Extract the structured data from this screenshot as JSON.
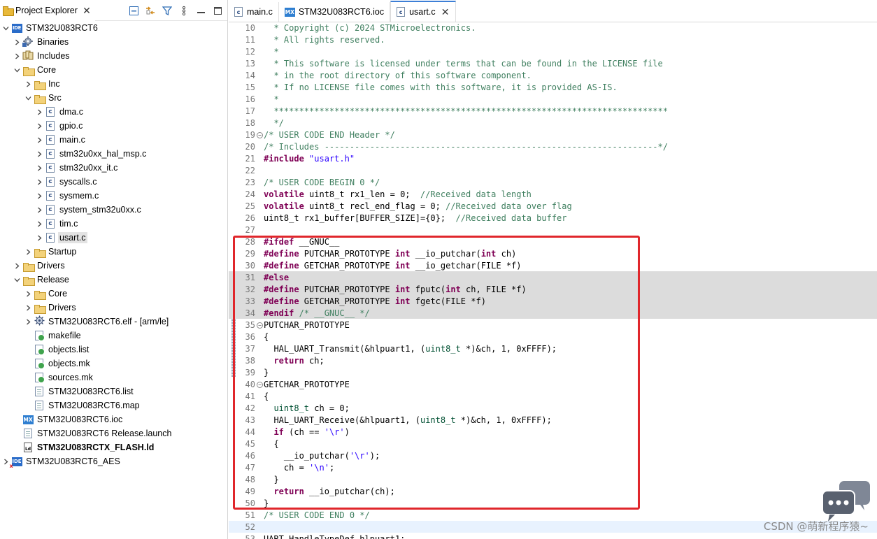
{
  "explorer": {
    "tab_label": "Project Explorer",
    "tree": [
      {
        "depth": 0,
        "arrow": "down",
        "icon": "ide",
        "label": "STM32U083RCT6"
      },
      {
        "depth": 1,
        "arrow": "right",
        "icon": "binaries",
        "label": "Binaries"
      },
      {
        "depth": 1,
        "arrow": "right",
        "icon": "includes",
        "label": "Includes"
      },
      {
        "depth": 1,
        "arrow": "down",
        "icon": "folder",
        "label": "Core"
      },
      {
        "depth": 2,
        "arrow": "right",
        "icon": "folder",
        "label": "Inc"
      },
      {
        "depth": 2,
        "arrow": "down",
        "icon": "folder",
        "label": "Src"
      },
      {
        "depth": 3,
        "arrow": "right",
        "icon": "cfile",
        "label": "dma.c"
      },
      {
        "depth": 3,
        "arrow": "right",
        "icon": "cfile",
        "label": "gpio.c"
      },
      {
        "depth": 3,
        "arrow": "right",
        "icon": "cfile",
        "label": "main.c"
      },
      {
        "depth": 3,
        "arrow": "right",
        "icon": "cfile",
        "label": "stm32u0xx_hal_msp.c"
      },
      {
        "depth": 3,
        "arrow": "right",
        "icon": "cfile",
        "label": "stm32u0xx_it.c"
      },
      {
        "depth": 3,
        "arrow": "right",
        "icon": "cfile",
        "label": "syscalls.c"
      },
      {
        "depth": 3,
        "arrow": "right",
        "icon": "cfile",
        "label": "sysmem.c"
      },
      {
        "depth": 3,
        "arrow": "right",
        "icon": "cfile",
        "label": "system_stm32u0xx.c"
      },
      {
        "depth": 3,
        "arrow": "right",
        "icon": "cfile",
        "label": "tim.c"
      },
      {
        "depth": 3,
        "arrow": "right",
        "icon": "cfile",
        "label": "usart.c",
        "selected": true
      },
      {
        "depth": 2,
        "arrow": "right",
        "icon": "folder",
        "label": "Startup"
      },
      {
        "depth": 1,
        "arrow": "right",
        "icon": "folder",
        "label": "Drivers"
      },
      {
        "depth": 1,
        "arrow": "down",
        "icon": "folder",
        "label": "Release"
      },
      {
        "depth": 2,
        "arrow": "right",
        "icon": "folder",
        "label": "Core"
      },
      {
        "depth": 2,
        "arrow": "right",
        "icon": "folder",
        "label": "Drivers"
      },
      {
        "depth": 2,
        "arrow": "right",
        "icon": "elf",
        "label": "STM32U083RCT6.elf - [arm/le]"
      },
      {
        "depth": 2,
        "arrow": "none",
        "icon": "mk",
        "label": "makefile"
      },
      {
        "depth": 2,
        "arrow": "none",
        "icon": "mk",
        "label": "objects.list"
      },
      {
        "depth": 2,
        "arrow": "none",
        "icon": "mk",
        "label": "objects.mk"
      },
      {
        "depth": 2,
        "arrow": "none",
        "icon": "mk",
        "label": "sources.mk"
      },
      {
        "depth": 2,
        "arrow": "none",
        "icon": "doc",
        "label": "STM32U083RCT6.list"
      },
      {
        "depth": 2,
        "arrow": "none",
        "icon": "doc",
        "label": "STM32U083RCT6.map"
      },
      {
        "depth": 1,
        "arrow": "none",
        "icon": "mx",
        "label": "STM32U083RCT6.ioc"
      },
      {
        "depth": 1,
        "arrow": "none",
        "icon": "doc",
        "label": "STM32U083RCT6 Release.launch"
      },
      {
        "depth": 1,
        "arrow": "none",
        "icon": "ld",
        "label": "STM32U083RCTX_FLASH.ld",
        "bold": true
      },
      {
        "depth": 0,
        "arrow": "right",
        "icon": "ide-x",
        "label": "STM32U083RCT6_AES"
      }
    ]
  },
  "editor": {
    "tabs": [
      {
        "label": "main.c",
        "icon": "cfile",
        "active": false
      },
      {
        "label": "STM32U083RCT6.ioc",
        "icon": "mx",
        "active": false
      },
      {
        "label": "usart.c",
        "icon": "cfile",
        "active": true
      }
    ],
    "lines": [
      {
        "n": "10",
        "seg": [
          [
            "com",
            "  * Copyright (c) 2024 STMicroelectronics."
          ]
        ]
      },
      {
        "n": "11",
        "seg": [
          [
            "com",
            "  * All rights reserved."
          ]
        ]
      },
      {
        "n": "12",
        "seg": [
          [
            "com",
            "  *"
          ]
        ]
      },
      {
        "n": "13",
        "seg": [
          [
            "com",
            "  * This software is licensed under terms that can be found in the LICENSE file"
          ]
        ]
      },
      {
        "n": "14",
        "seg": [
          [
            "com",
            "  * in the root directory of this software component."
          ]
        ]
      },
      {
        "n": "15",
        "seg": [
          [
            "com",
            "  * If no LICENSE file comes with this software, it is provided AS-IS."
          ]
        ]
      },
      {
        "n": "16",
        "seg": [
          [
            "com",
            "  *"
          ]
        ]
      },
      {
        "n": "17",
        "seg": [
          [
            "com",
            "  ******************************************************************************"
          ]
        ]
      },
      {
        "n": "18",
        "seg": [
          [
            "com",
            "  */"
          ]
        ]
      },
      {
        "n": "19",
        "fold": true,
        "seg": [
          [
            "com",
            "/* USER CODE END Header */"
          ]
        ]
      },
      {
        "n": "20",
        "seg": [
          [
            "com",
            "/* Includes ------------------------------------------------------------------*/"
          ]
        ]
      },
      {
        "n": "21",
        "seg": [
          [
            "pp",
            "#include "
          ],
          [
            "str",
            "\"usart.h\""
          ]
        ]
      },
      {
        "n": "22",
        "seg": [
          [
            "plain",
            ""
          ]
        ]
      },
      {
        "n": "23",
        "seg": [
          [
            "com",
            "/* USER CODE BEGIN 0 */"
          ]
        ]
      },
      {
        "n": "24",
        "seg": [
          [
            "kw",
            "volatile"
          ],
          [
            "plain",
            " uint8_t rx1_len = 0;  "
          ],
          [
            "com",
            "//Received data length"
          ]
        ]
      },
      {
        "n": "25",
        "seg": [
          [
            "kw",
            "volatile"
          ],
          [
            "plain",
            " uint8_t recl_end_flag = 0; "
          ],
          [
            "com",
            "//Received data over flag"
          ]
        ]
      },
      {
        "n": "26",
        "seg": [
          [
            "plain",
            "uint8_t rx1_buffer[BUFFER_SIZE]={0};  "
          ],
          [
            "com",
            "//Received data buffer"
          ]
        ]
      },
      {
        "n": "27",
        "seg": [
          [
            "plain",
            ""
          ]
        ]
      },
      {
        "n": "28",
        "seg": [
          [
            "pp",
            "#ifdef"
          ],
          [
            "plain",
            " __GNUC__"
          ]
        ]
      },
      {
        "n": "29",
        "seg": [
          [
            "pp",
            "#define"
          ],
          [
            "plain",
            " PUTCHAR_PROTOTYPE "
          ],
          [
            "kw",
            "int"
          ],
          [
            "plain",
            " __io_putchar("
          ],
          [
            "kw",
            "int"
          ],
          [
            "plain",
            " ch)"
          ]
        ]
      },
      {
        "n": "30",
        "seg": [
          [
            "pp",
            "#define"
          ],
          [
            "plain",
            " GETCHAR_PROTOTYPE "
          ],
          [
            "kw",
            "int"
          ],
          [
            "plain",
            " __io_getchar(FILE *f)"
          ]
        ]
      },
      {
        "n": "31",
        "hl": true,
        "seg": [
          [
            "pp",
            "#else"
          ]
        ]
      },
      {
        "n": "32",
        "hl": true,
        "seg": [
          [
            "pp",
            "#define"
          ],
          [
            "plain",
            " PUTCHAR_PROTOTYPE "
          ],
          [
            "kw",
            "int"
          ],
          [
            "plain",
            " fputc("
          ],
          [
            "kw",
            "int"
          ],
          [
            "plain",
            " ch, FILE *f)"
          ]
        ]
      },
      {
        "n": "33",
        "hl": true,
        "seg": [
          [
            "pp",
            "#define"
          ],
          [
            "plain",
            " GETCHAR_PROTOTYPE "
          ],
          [
            "kw",
            "int"
          ],
          [
            "plain",
            " fgetc(FILE *f)"
          ]
        ]
      },
      {
        "n": "34",
        "hl": true,
        "seg": [
          [
            "pp",
            "#endif"
          ],
          [
            "com",
            " /* __GNUC__ */"
          ]
        ]
      },
      {
        "n": "35",
        "fold": true,
        "seg": [
          [
            "plain",
            "PUTCHAR_PROTOTYPE"
          ]
        ]
      },
      {
        "n": "36",
        "seg": [
          [
            "plain",
            "{"
          ]
        ]
      },
      {
        "n": "37",
        "seg": [
          [
            "plain",
            "  HAL_UART_Transmit(&hlpuart1, ("
          ],
          [
            "type",
            "uint8_t"
          ],
          [
            "plain",
            " *)&ch, 1, 0xFFFF);"
          ]
        ]
      },
      {
        "n": "38",
        "seg": [
          [
            "plain",
            "  "
          ],
          [
            "kw",
            "return"
          ],
          [
            "plain",
            " ch;"
          ]
        ]
      },
      {
        "n": "39",
        "seg": [
          [
            "plain",
            "}"
          ]
        ]
      },
      {
        "n": "40",
        "fold": true,
        "seg": [
          [
            "plain",
            "GETCHAR_PROTOTYPE"
          ]
        ]
      },
      {
        "n": "41",
        "seg": [
          [
            "plain",
            "{"
          ]
        ]
      },
      {
        "n": "42",
        "seg": [
          [
            "plain",
            "  "
          ],
          [
            "type",
            "uint8_t"
          ],
          [
            "plain",
            " ch = 0;"
          ]
        ]
      },
      {
        "n": "43",
        "seg": [
          [
            "plain",
            "  HAL_UART_Receive(&hlpuart1, ("
          ],
          [
            "type",
            "uint8_t"
          ],
          [
            "plain",
            " *)&ch, 1, 0xFFFF);"
          ]
        ]
      },
      {
        "n": "44",
        "seg": [
          [
            "plain",
            "  "
          ],
          [
            "kw",
            "if"
          ],
          [
            "plain",
            " (ch == "
          ],
          [
            "str",
            "'\\r'"
          ],
          [
            "plain",
            ")"
          ]
        ]
      },
      {
        "n": "45",
        "seg": [
          [
            "plain",
            "  {"
          ]
        ]
      },
      {
        "n": "46",
        "seg": [
          [
            "plain",
            "    __io_putchar("
          ],
          [
            "str",
            "'\\r'"
          ],
          [
            "plain",
            ");"
          ]
        ]
      },
      {
        "n": "47",
        "seg": [
          [
            "plain",
            "    ch = "
          ],
          [
            "str",
            "'\\n'"
          ],
          [
            "plain",
            ";"
          ]
        ]
      },
      {
        "n": "48",
        "seg": [
          [
            "plain",
            "  }"
          ]
        ]
      },
      {
        "n": "49",
        "seg": [
          [
            "plain",
            "  "
          ],
          [
            "kw",
            "return"
          ],
          [
            "plain",
            " __io_putchar(ch);"
          ]
        ]
      },
      {
        "n": "50",
        "seg": [
          [
            "plain",
            "}"
          ]
        ]
      },
      {
        "n": "51",
        "seg": [
          [
            "com",
            "/* USER CODE END 0 */"
          ]
        ]
      },
      {
        "n": "52",
        "cursor": true,
        "seg": [
          [
            "plain",
            ""
          ]
        ]
      },
      {
        "n": "53",
        "seg": [
          [
            "plain",
            "UART_HandleTypeDef hlpuart1;"
          ]
        ]
      }
    ]
  },
  "watermark": "CSDN @萌新程序猿~"
}
